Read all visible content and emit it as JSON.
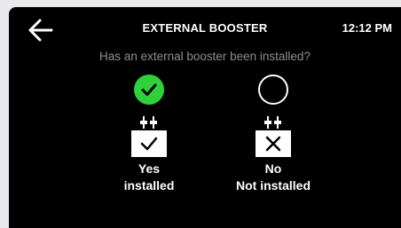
{
  "header": {
    "title": "EXTERNAL BOOSTER",
    "time": "12:12 PM"
  },
  "question": "Has an external booster been installed?",
  "options": [
    {
      "line1": "Yes",
      "line2": "installed",
      "selected": true
    },
    {
      "line1": "No",
      "line2": "Not installed",
      "selected": false
    }
  ],
  "colors": {
    "background": "#000000",
    "selected": "#2fd13a",
    "question_text": "#8e8e8e",
    "text": "#ffffff"
  },
  "icons": {
    "back": "arrow-left-icon",
    "selected_radio": "check-circle-icon",
    "unselected_radio": "empty-circle-icon",
    "plug": "plug-icon",
    "yes_device": "checkmark-box-icon",
    "no_device": "x-box-icon"
  }
}
